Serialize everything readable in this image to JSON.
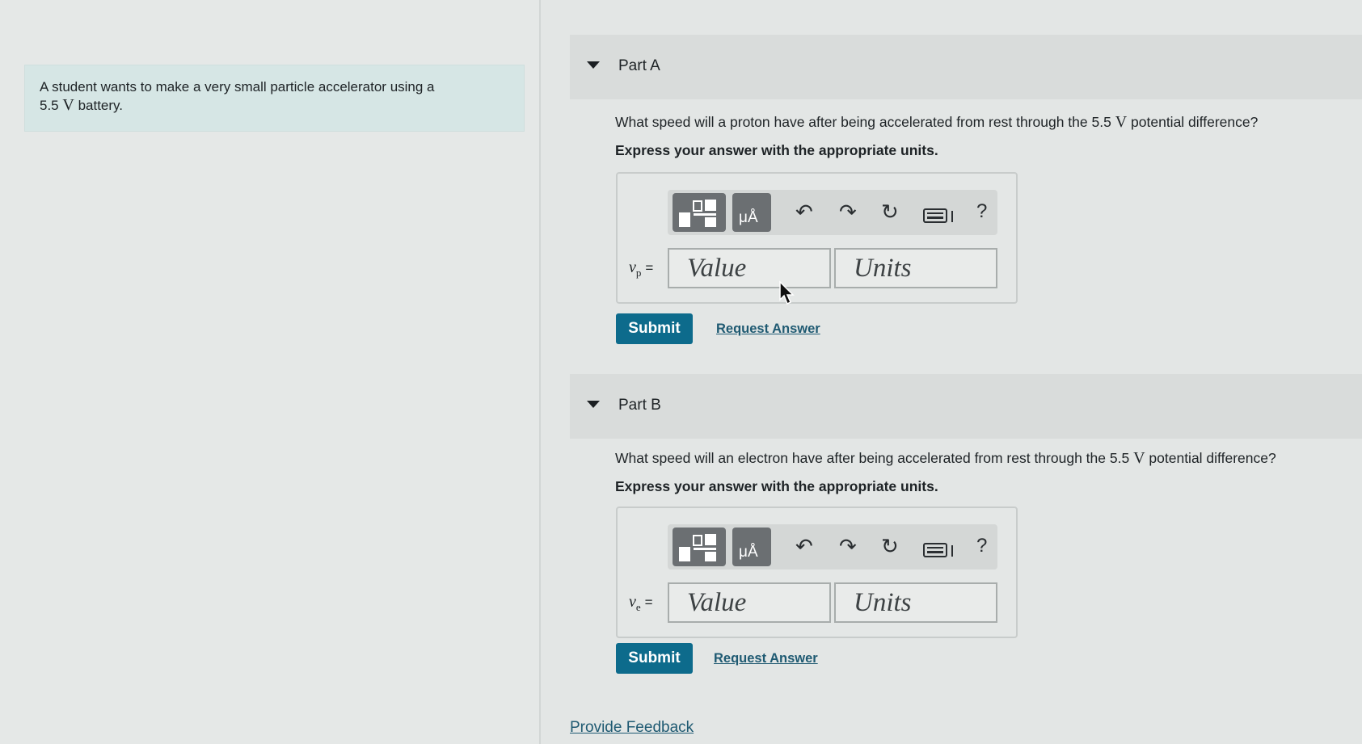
{
  "problem": {
    "text_before": "A student wants to make a very small particle accelerator using a",
    "voltage_value": "5.5",
    "voltage_unit": "V",
    "text_after": "battery."
  },
  "parts": [
    {
      "title": "Part A",
      "question_before": "What speed will a proton have after being accelerated from rest through the 5.5",
      "question_unit": "V",
      "question_after": "potential difference?",
      "instruction": "Express your answer with the appropriate units.",
      "variable": "v",
      "variable_sub": "p",
      "variable_eq": "=",
      "value_placeholder": "Value",
      "units_placeholder": "Units",
      "submit_label": "Submit",
      "request_label": "Request Answer"
    },
    {
      "title": "Part B",
      "question_before": "What speed will an electron have after being accelerated from rest through the 5.5",
      "question_unit": "V",
      "question_after": "potential difference?",
      "instruction": "Express your answer with the appropriate units.",
      "variable": "v",
      "variable_sub": "e",
      "variable_eq": "=",
      "value_placeholder": "Value",
      "units_placeholder": "Units",
      "submit_label": "Submit",
      "request_label": "Request Answer"
    }
  ],
  "toolbar": {
    "units_glyph": "μÅ",
    "help_label": "?"
  },
  "feedback_label": "Provide Feedback",
  "colors": {
    "submit_bg": "#0d6b8c",
    "link": "#1f5a72",
    "problem_bg": "#d6e6e5"
  }
}
